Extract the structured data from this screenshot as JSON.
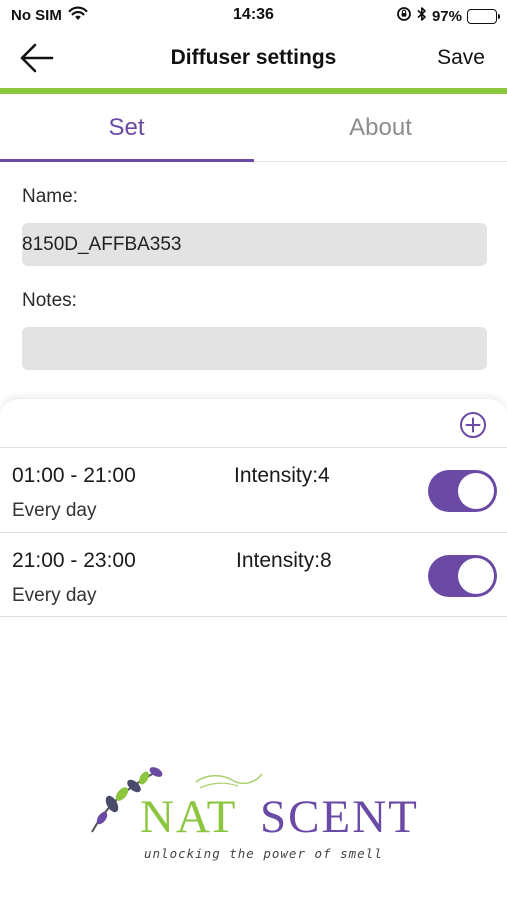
{
  "status_bar": {
    "carrier": "No SIM",
    "time": "14:36",
    "battery_percent": "97%",
    "battery_level": 0.97
  },
  "nav": {
    "title": "Diffuser settings",
    "save_label": "Save"
  },
  "tabs": [
    {
      "label": "Set",
      "active": true
    },
    {
      "label": "About",
      "active": false
    }
  ],
  "form": {
    "name_label": "Name:",
    "name_value": "8150D_AFFBA353",
    "notes_label": "Notes:",
    "notes_value": ""
  },
  "schedules": [
    {
      "time_range": "01:00 - 21:00",
      "repeat": "Every day",
      "intensity": "Intensity:4",
      "enabled": true
    },
    {
      "time_range": "21:00 - 23:00",
      "repeat": "Every day",
      "intensity": "Intensity:8",
      "enabled": true
    }
  ],
  "logo": {
    "part_nat": "NAT",
    "part_scent": "SCENT",
    "tagline": "unlocking the power of smell"
  },
  "colors": {
    "accent_purple": "#6a4aa5",
    "brand_green": "#8cc63f",
    "field_gray": "#e3e3e3"
  }
}
